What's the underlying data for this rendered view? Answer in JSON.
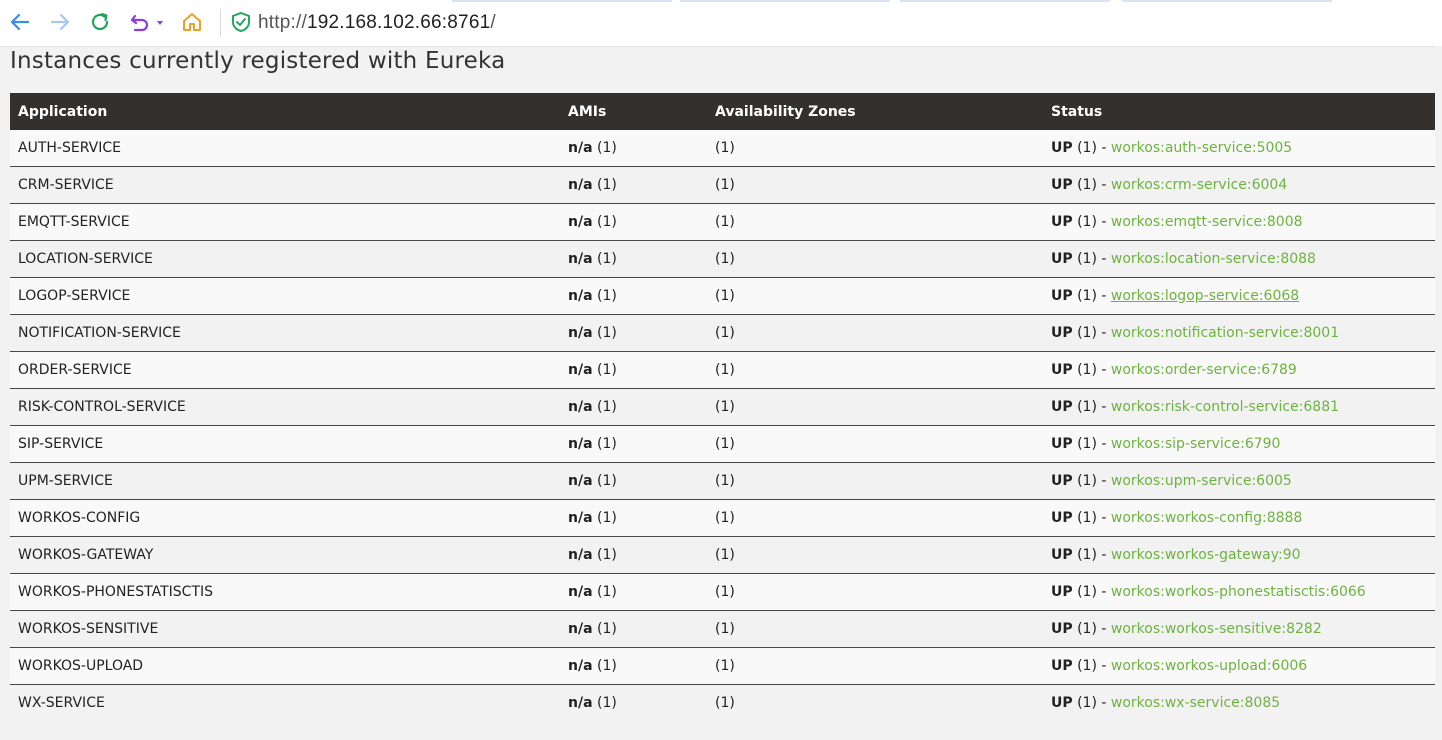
{
  "browser": {
    "url_protocol": "http://",
    "url_host": "192.168.102.66:8761",
    "url_slash": "/"
  },
  "page": {
    "title": "Instances currently registered with Eureka"
  },
  "table": {
    "headers": {
      "application": "Application",
      "amis": "AMIs",
      "availability_zones": "Availability Zones",
      "status": "Status"
    },
    "rows": [
      {
        "app": "AUTH-SERVICE",
        "ami": "n/a",
        "ami_count": "(1)",
        "az": "(1)",
        "status": "UP",
        "status_count": "(1) -",
        "instance": "workos:auth-service:5005"
      },
      {
        "app": "CRM-SERVICE",
        "ami": "n/a",
        "ami_count": "(1)",
        "az": "(1)",
        "status": "UP",
        "status_count": "(1) -",
        "instance": "workos:crm-service:6004"
      },
      {
        "app": "EMQTT-SERVICE",
        "ami": "n/a",
        "ami_count": "(1)",
        "az": "(1)",
        "status": "UP",
        "status_count": "(1) -",
        "instance": "workos:emqtt-service:8008"
      },
      {
        "app": "LOCATION-SERVICE",
        "ami": "n/a",
        "ami_count": "(1)",
        "az": "(1)",
        "status": "UP",
        "status_count": "(1) -",
        "instance": "workos:location-service:8088"
      },
      {
        "app": "LOGOP-SERVICE",
        "ami": "n/a",
        "ami_count": "(1)",
        "az": "(1)",
        "status": "UP",
        "status_count": "(1) -",
        "instance": "workos:logop-service:6068"
      },
      {
        "app": "NOTIFICATION-SERVICE",
        "ami": "n/a",
        "ami_count": "(1)",
        "az": "(1)",
        "status": "UP",
        "status_count": "(1) -",
        "instance": "workos:notification-service:8001"
      },
      {
        "app": "ORDER-SERVICE",
        "ami": "n/a",
        "ami_count": "(1)",
        "az": "(1)",
        "status": "UP",
        "status_count": "(1) -",
        "instance": "workos:order-service:6789"
      },
      {
        "app": "RISK-CONTROL-SERVICE",
        "ami": "n/a",
        "ami_count": "(1)",
        "az": "(1)",
        "status": "UP",
        "status_count": "(1) -",
        "instance": "workos:risk-control-service:6881"
      },
      {
        "app": "SIP-SERVICE",
        "ami": "n/a",
        "ami_count": "(1)",
        "az": "(1)",
        "status": "UP",
        "status_count": "(1) -",
        "instance": "workos:sip-service:6790"
      },
      {
        "app": "UPM-SERVICE",
        "ami": "n/a",
        "ami_count": "(1)",
        "az": "(1)",
        "status": "UP",
        "status_count": "(1) -",
        "instance": "workos:upm-service:6005"
      },
      {
        "app": "WORKOS-CONFIG",
        "ami": "n/a",
        "ami_count": "(1)",
        "az": "(1)",
        "status": "UP",
        "status_count": "(1) -",
        "instance": "workos:workos-config:8888"
      },
      {
        "app": "WORKOS-GATEWAY",
        "ami": "n/a",
        "ami_count": "(1)",
        "az": "(1)",
        "status": "UP",
        "status_count": "(1) -",
        "instance": "workos:workos-gateway:90"
      },
      {
        "app": "WORKOS-PHONESTATISCTIS",
        "ami": "n/a",
        "ami_count": "(1)",
        "az": "(1)",
        "status": "UP",
        "status_count": "(1) -",
        "instance": "workos:workos-phonestatisctis:6066"
      },
      {
        "app": "WORKOS-SENSITIVE",
        "ami": "n/a",
        "ami_count": "(1)",
        "az": "(1)",
        "status": "UP",
        "status_count": "(1) -",
        "instance": "workos:workos-sensitive:8282"
      },
      {
        "app": "WORKOS-UPLOAD",
        "ami": "n/a",
        "ami_count": "(1)",
        "az": "(1)",
        "status": "UP",
        "status_count": "(1) -",
        "instance": "workos:workos-upload:6006"
      },
      {
        "app": "WX-SERVICE",
        "ami": "n/a",
        "ami_count": "(1)",
        "az": "(1)",
        "status": "UP",
        "status_count": "(1) -",
        "instance": "workos:wx-service:8085"
      }
    ]
  },
  "icons": {
    "back": "arrow-left-icon",
    "forward": "arrow-right-icon",
    "reload": "reload-icon",
    "undo": "undo-icon",
    "home": "home-icon",
    "secure": "shield-check-icon"
  },
  "colors": {
    "header_bg": "#34302d",
    "instance_link": "#6db33f",
    "nav_blue": "#3a8ee6",
    "reload_green": "#22a35a",
    "undo_purple": "#8a3ee0",
    "home_orange": "#f0a020"
  }
}
